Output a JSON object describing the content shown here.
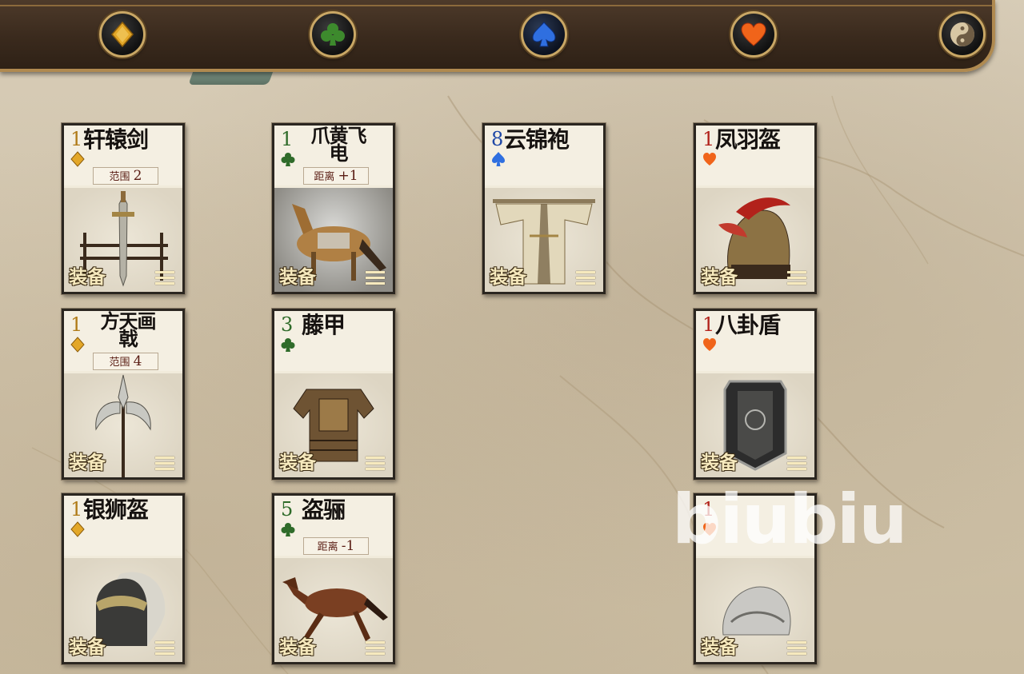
{
  "suit_bar": {
    "buttons": [
      {
        "icon": "diamond-icon",
        "color": "#e3a728"
      },
      {
        "icon": "club-icon",
        "color": "#3d8a2d"
      },
      {
        "icon": "spade-icon",
        "color": "#2f6fe0",
        "active": true
      },
      {
        "icon": "heart-icon",
        "color": "#f0641a"
      },
      {
        "icon": "yin-yang-icon",
        "color": "#d8c7a4"
      }
    ]
  },
  "cards": [
    {
      "id": "xuanyuan",
      "number": "1",
      "suit": "diamond",
      "name": "轩辕剑",
      "tag_label": "范围",
      "tag_value": "2",
      "type": "装备"
    },
    {
      "id": "zhuahuang",
      "number": "1",
      "suit": "club",
      "name": "爪黄飞电",
      "tag_label": "距离",
      "tag_value": "+1",
      "type": "装备"
    },
    {
      "id": "yunjin",
      "number": "8",
      "suit": "spade",
      "name": "云锦袍",
      "tag_label": "",
      "tag_value": "",
      "type": "装备"
    },
    {
      "id": "fengyu",
      "number": "1",
      "suit": "heart",
      "name": "凤羽盔",
      "tag_label": "",
      "tag_value": "",
      "type": "装备"
    },
    {
      "id": "fangtian",
      "number": "1",
      "suit": "diamond",
      "name": "方天画戟",
      "tag_label": "范围",
      "tag_value": "4",
      "type": "装备"
    },
    {
      "id": "tengjia",
      "number": "3",
      "suit": "club",
      "name": "藤甲",
      "tag_label": "",
      "tag_value": "",
      "type": "装备"
    },
    {
      "id": "bagua",
      "number": "1",
      "suit": "heart",
      "name": "八卦盾",
      "tag_label": "",
      "tag_value": "",
      "type": "装备"
    },
    {
      "id": "yinshi",
      "number": "1",
      "suit": "diamond",
      "name": "银狮盔",
      "tag_label": "",
      "tag_value": "",
      "type": "装备"
    },
    {
      "id": "daoli",
      "number": "5",
      "suit": "club",
      "name": "盗骊",
      "tag_label": "距离",
      "tag_value": "-1",
      "type": "装备"
    },
    {
      "id": "unknown",
      "number": "1",
      "suit": "heart",
      "name": "",
      "tag_label": "",
      "tag_value": "",
      "type": "装备"
    }
  ],
  "watermark": "biubiu",
  "colors": {
    "red": "#b2221b",
    "green": "#2f6b2a",
    "blue": "#1f48a6",
    "gold": "#b07b18"
  }
}
